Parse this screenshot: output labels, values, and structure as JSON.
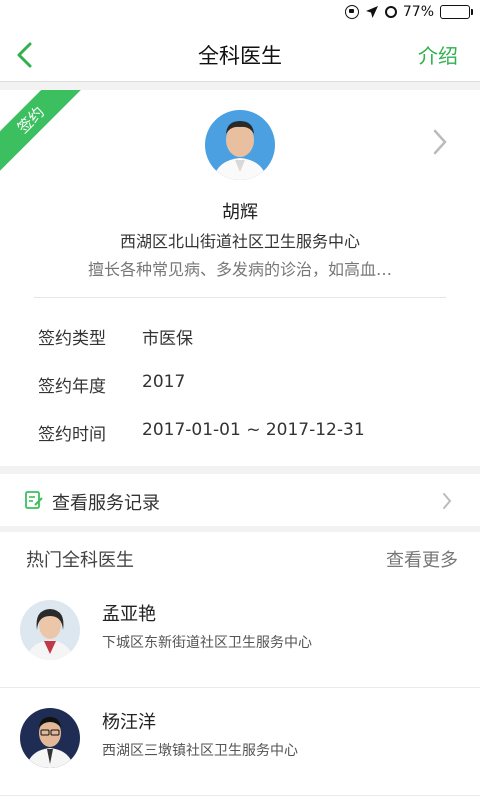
{
  "status_bar": {
    "battery": "77%",
    "battery_level": 0.77
  },
  "nav": {
    "title": "全科医生",
    "right_action": "介绍"
  },
  "doctor": {
    "badge": "签约",
    "name": "胡辉",
    "organization": "西湖区北山街道社区卫生服务中心",
    "specialty": "擅长各种常见病、多发病的诊治，如高血…",
    "details": [
      {
        "label": "签约类型",
        "value": "市医保"
      },
      {
        "label": "签约年度",
        "value": "2017"
      },
      {
        "label": "签约时间",
        "value": "2017-01-01 ~ 2017-12-31"
      }
    ]
  },
  "service_record": {
    "label": "查看服务记录"
  },
  "hot_doctors": {
    "title": "热门全科医生",
    "more": "查看更多",
    "items": [
      {
        "name": "孟亚艳",
        "organization": "下城区东新街道社区卫生服务中心"
      },
      {
        "name": "杨汪洋",
        "organization": "西湖区三墩镇社区卫生服务中心"
      }
    ]
  },
  "colors": {
    "accent": "#2fb24e",
    "badge": "#3cbf5f"
  }
}
